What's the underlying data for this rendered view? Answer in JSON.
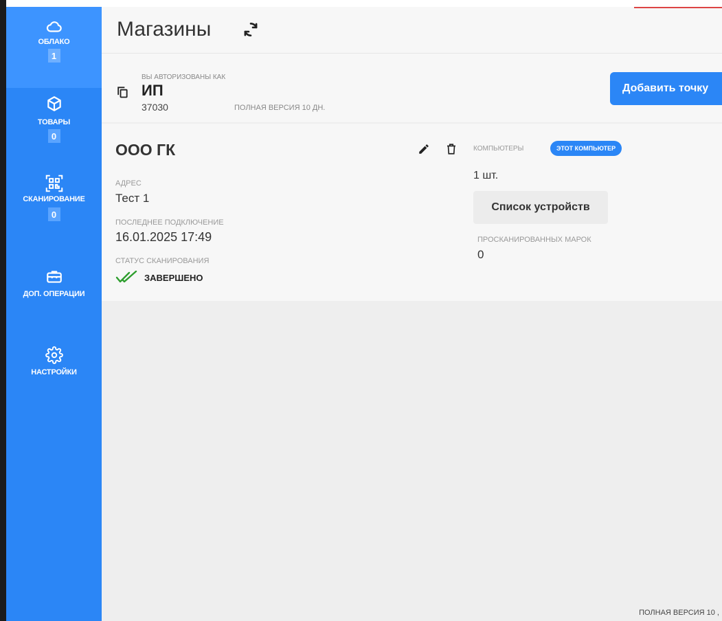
{
  "sidebar": {
    "items": [
      {
        "label": "ОБЛАКО",
        "badge": "1",
        "icon": "cloud-icon"
      },
      {
        "label": "ТОВАРЫ",
        "badge": "0",
        "icon": "box-icon"
      },
      {
        "label": "СКАНИРОВАНИЕ",
        "badge": "0",
        "icon": "qr-scan-icon"
      },
      {
        "label": "ДОП. ОПЕРАЦИИ",
        "icon": "toolbox-icon"
      },
      {
        "label": "НАСТРОЙКИ",
        "icon": "gear-icon"
      }
    ]
  },
  "header": {
    "title": "Магазины"
  },
  "auth": {
    "caption": "ВЫ АВТОРИЗОВАНЫ КАК",
    "name": "ИП",
    "inn": "37030",
    "version": "ПОЛНАЯ ВЕРСИЯ 10 ДН.",
    "add_button": "Добавить точку"
  },
  "store": {
    "name": "ООО ГК",
    "address_label": "АДРЕС",
    "address": "Тест 1",
    "last_conn_label": "ПОСЛЕДНЕЕ ПОДКЛЮЧЕНИЕ",
    "last_conn": "16.01.2025 17:49",
    "scan_status_label": "СТАТУС СКАНИРОВАНИЯ",
    "scan_status": "ЗАВЕРШЕНО",
    "computers_label": "КОМПЬЮТЕРЫ",
    "this_computer": "ЭТОТ КОМПЬЮТЕР",
    "computers_count": "1 шт.",
    "devices_button": "Список устройств",
    "scanned_label": "ПРОСКАНИРОВАННЫХ МАРОК",
    "scanned_value": "0"
  },
  "footer": {
    "version": "ПОЛНАЯ ВЕРСИЯ 10 ,"
  },
  "colors": {
    "accent": "#2b86f6",
    "sidebar": "#2b86f6",
    "success": "#2e9e2e"
  }
}
